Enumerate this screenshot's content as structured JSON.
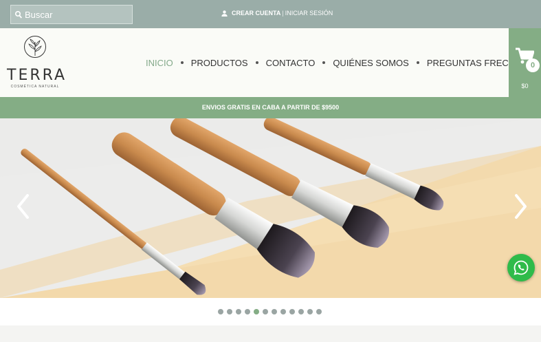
{
  "search": {
    "placeholder": "Buscar"
  },
  "account": {
    "create_label": "CREAR CUENTA",
    "separator": "|",
    "login_label": "INICIAR SESIÓN"
  },
  "logo": {
    "brand": "TERRA",
    "tagline": "COSMÉTICA NATURAL"
  },
  "nav": {
    "items": [
      {
        "label": "INICIO",
        "active": true
      },
      {
        "label": "PRODUCTOS",
        "active": false
      },
      {
        "label": "CONTACTO",
        "active": false
      },
      {
        "label": "QUIÉNES SOMOS",
        "active": false
      },
      {
        "label": "PREGUNTAS FRECUENTES",
        "active": false
      }
    ]
  },
  "cart": {
    "count": "0",
    "total": "$0"
  },
  "promo": {
    "text": "ENVIOS GRATIS EN CABA A PARTIR DE $9500"
  },
  "slider": {
    "slide_count": 12,
    "active_index": 4
  },
  "colors": {
    "topbar": "#9aada8",
    "accent": "#84ad85",
    "whatsapp": "#2fbb4a"
  },
  "icons": [
    "search-icon",
    "user-icon",
    "cart-icon",
    "chevron-left-icon",
    "chevron-right-icon",
    "whatsapp-icon"
  ]
}
